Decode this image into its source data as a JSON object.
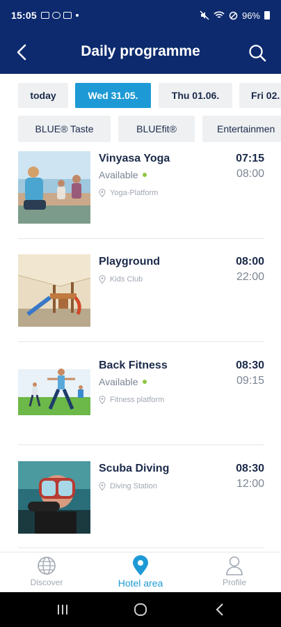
{
  "status_bar": {
    "time": "15:05",
    "battery": "96%"
  },
  "header": {
    "title": "Daily programme"
  },
  "date_tabs": [
    {
      "label": "today"
    },
    {
      "label": "Wed 31.05."
    },
    {
      "label": "Thu 01.06."
    },
    {
      "label": "Fri 02."
    }
  ],
  "categories": [
    {
      "label": "BLUE® Taste"
    },
    {
      "label": "BLUEfit®"
    },
    {
      "label": "Entertainmen"
    }
  ],
  "activities": [
    {
      "title": "Vinyasa Yoga",
      "availability": "Available",
      "location": "Yoga-Platform",
      "start": "07:15",
      "end": "08:00"
    },
    {
      "title": "Playground",
      "availability": "",
      "location": "Kids Club",
      "start": "08:00",
      "end": "22:00"
    },
    {
      "title": "Back Fitness",
      "availability": "Available",
      "location": "Fitness platform",
      "start": "08:30",
      "end": "09:15"
    },
    {
      "title": "Scuba Diving",
      "availability": "",
      "location": "Diving Station",
      "start": "08:30",
      "end": "12:00"
    }
  ],
  "bottom_nav": [
    {
      "label": "Discover",
      "icon": "globe-icon"
    },
    {
      "label": "Hotel area",
      "icon": "location-pin-icon"
    },
    {
      "label": "Profile",
      "icon": "person-icon"
    }
  ],
  "colors": {
    "primary": "#0d2a6e",
    "accent": "#1d9ad6",
    "available": "#8dc63f"
  }
}
